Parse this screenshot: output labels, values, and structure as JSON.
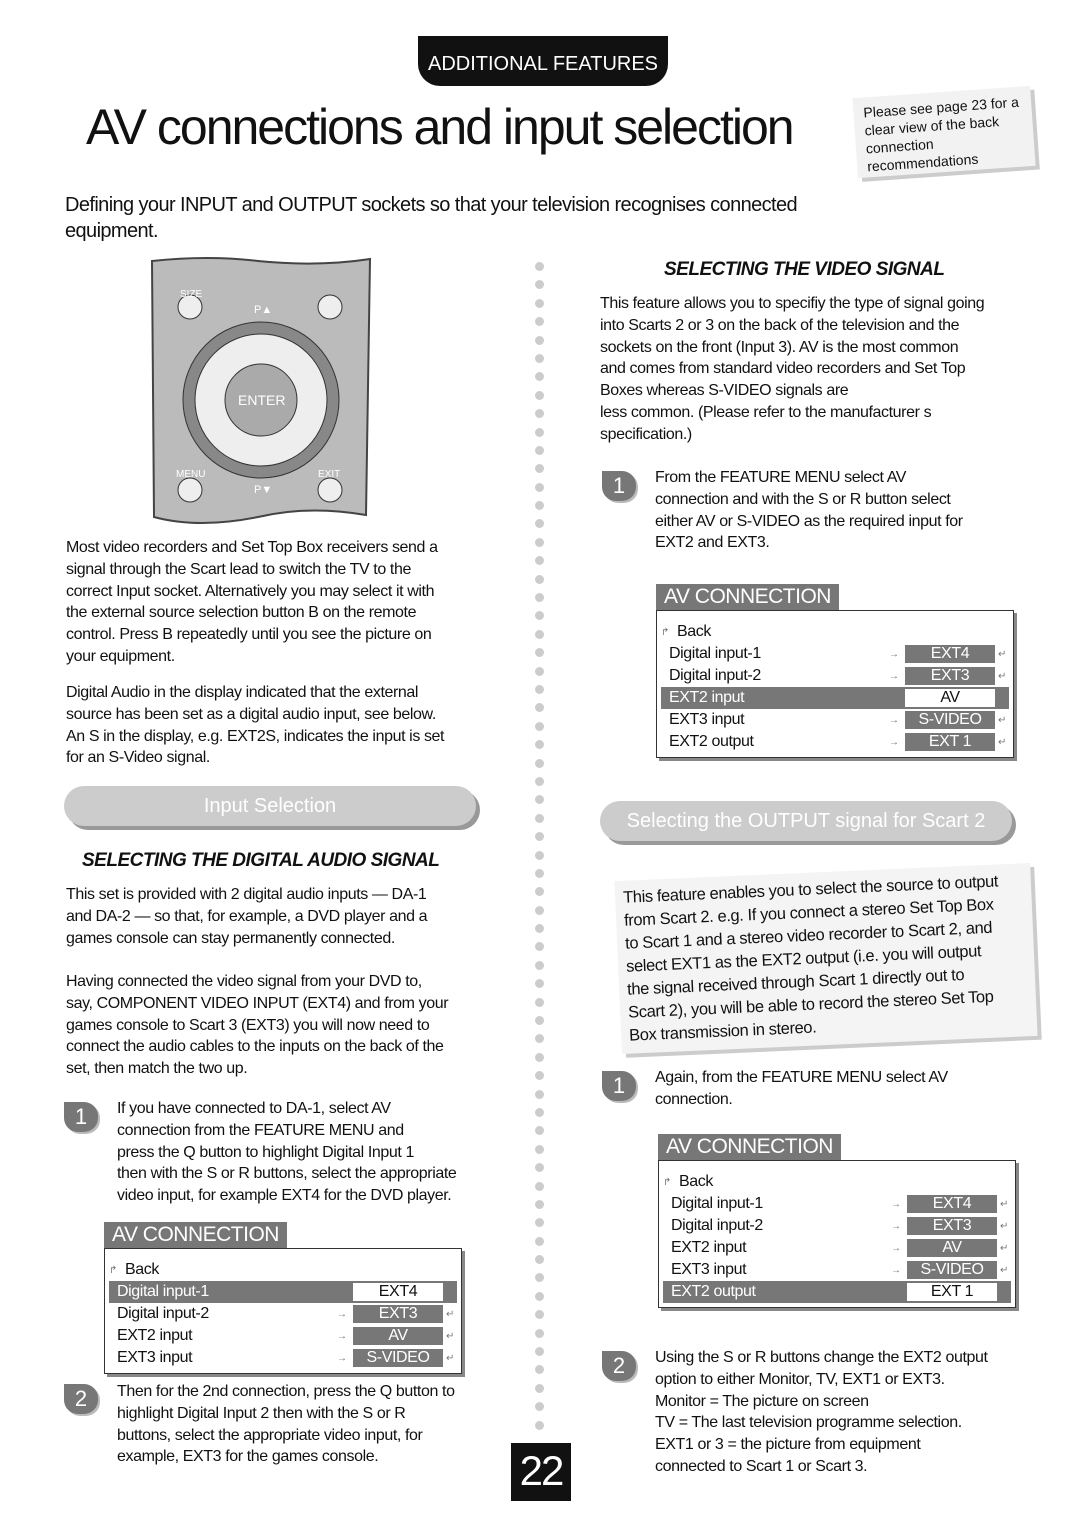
{
  "header": {
    "section": "ADDITIONAL FEATURES",
    "title": "AV connections and input selection",
    "note": "Please see page 23 for a clear view of the back connection recommendations"
  },
  "intro": "Defining your INPUT and OUTPUT sockets so that your television recognises connected equipment.",
  "remote": {
    "size": "SIZE",
    "p_up": "P▲",
    "enter": "ENTER",
    "menu": "MENU",
    "exit": "EXIT",
    "p_down": "P▼"
  },
  "left": {
    "p1": [
      "Most video recorders and Set Top Box receivers send a",
      "signal through the Scart lead to switch the TV to the",
      "correct Input socket. Alternatively you may select it with",
      "the external source selection button B on the remote",
      "control. Press B repeatedly until you see the picture on",
      "your equipment."
    ],
    "p2": [
      "Digital Audio in the display indicated that the external",
      "source has been set as a digital audio input, see below.",
      "An S in the display, e.g. EXT2S, indicates the input is set",
      "for an S-Video signal."
    ],
    "pill": "Input Selection",
    "heading": "SELECTING THE DIGITAL AUDIO SIGNAL",
    "p3": [
      "This set is provided with 2 digital audio inputs — DA-1",
      "and DA-2 — so that, for example, a DVD player and a",
      "games console can stay permanently connected."
    ],
    "p4": [
      "Having connected the video signal from your DVD to,",
      "say, COMPONENT VIDEO INPUT (EXT4) and from your",
      "games console to Scart 3 (EXT3) you will now need to",
      "connect the audio cables to the inputs on the back of the",
      "set, then match the two up."
    ],
    "step1_num": "1",
    "step1": [
      "If you have connected to DA-1, select AV",
      "connection from the FEATURE MENU and",
      "press the Q button to highlight Digital Input 1",
      "then with the S or R buttons, select the appropriate",
      "video input, for example EXT4 for the DVD player."
    ],
    "step2_num": "2",
    "step2": [
      "Then for the 2nd connection, press the Q button to",
      "highlight Digital Input 2 then with the S or R",
      "buttons, select the appropriate video input, for",
      "example, EXT3 for the games console."
    ]
  },
  "right": {
    "heading": "SELECTING THE VIDEO SIGNAL",
    "p1": [
      "This feature allows you to specifiy the type of signal going",
      "into Scarts 2 or 3 on the back of the television and the",
      "sockets on the front (Input 3). AV is the most common",
      "and comes from standard video recorders and Set Top",
      "Boxes whereas S-VIDEO signals are",
      "less common. (Please refer to the manufacturer s",
      "specification.)"
    ],
    "step1_num": "1",
    "step1": [
      "From the FEATURE MENU select AV",
      "connection and with the S or R button select",
      "either AV or S-VIDEO as the required input for",
      "EXT2 and EXT3."
    ],
    "pill": "Selecting the OUTPUT signal for Scart 2",
    "note": [
      "This feature enables you to select the source to output",
      "from Scart 2. e.g. If you connect a stereo Set Top Box",
      "to Scart 1 and a stereo video recorder to Scart 2, and",
      "select EXT1 as the EXT2 output (i.e. you will output",
      "the signal received through Scart 1 directly out to",
      "Scart 2), you will be able to record the stereo Set Top",
      "Box transmission in stereo."
    ],
    "step2_num": "1",
    "step2": [
      "Again, from the FEATURE MENU select AV",
      "connection."
    ],
    "step3_num": "2",
    "step3": [
      "Using the S or R buttons change the EXT2 output",
      "option to either Monitor, TV, EXT1 or EXT3.",
      "Monitor = The picture on screen",
      "TV = The last television programme selection.",
      "EXT1 or 3 = the picture from equipment",
      "connected to Scart 1 or Scart 3."
    ]
  },
  "menus": [
    {
      "title": "AV CONNECTION",
      "back": "Back",
      "rows": [
        {
          "label": "Digital input-1",
          "value": "EXT4",
          "selected": true
        },
        {
          "label": "Digital input-2",
          "value": "EXT3"
        },
        {
          "label": "EXT2 input",
          "value": "AV"
        },
        {
          "label": "EXT3 input",
          "value": "S-VIDEO"
        }
      ]
    },
    {
      "title": "AV CONNECTION",
      "back": "Back",
      "rows": [
        {
          "label": "Digital input-1",
          "value": "EXT4"
        },
        {
          "label": "Digital input-2",
          "value": "EXT3"
        },
        {
          "label": "EXT2 input",
          "value": "AV",
          "selected": true
        },
        {
          "label": "EXT3 input",
          "value": "S-VIDEO"
        },
        {
          "label": "EXT2 output",
          "value": "EXT 1"
        }
      ]
    },
    {
      "title": "AV CONNECTION",
      "back": "Back",
      "rows": [
        {
          "label": "Digital input-1",
          "value": "EXT4"
        },
        {
          "label": "Digital input-2",
          "value": "EXT3"
        },
        {
          "label": "EXT2 input",
          "value": "AV"
        },
        {
          "label": "EXT3 input",
          "value": "S-VIDEO"
        },
        {
          "label": "EXT2 output",
          "value": "EXT 1",
          "selected": true
        }
      ]
    }
  ],
  "page_number": "22"
}
